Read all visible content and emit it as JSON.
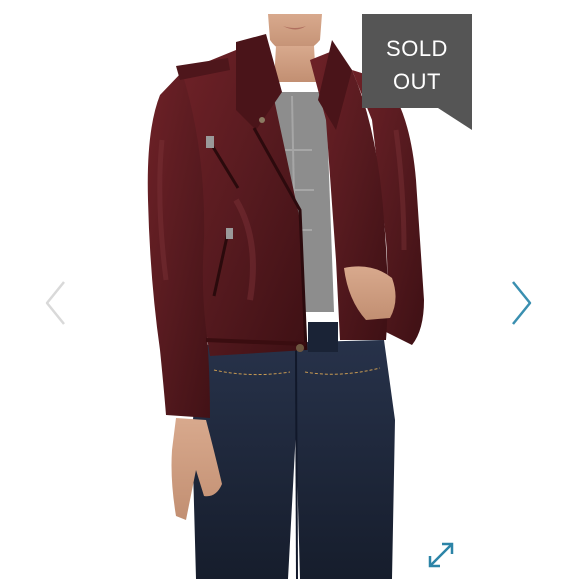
{
  "badge": {
    "line1": "SOLD",
    "line2": "OUT",
    "bg_color": "#555555",
    "text_color": "#ffffff"
  },
  "navigation": {
    "prev_icon": "chevron-left-icon",
    "next_icon": "chevron-right-icon",
    "prev_color": "#d9d9d9",
    "next_color": "#3a8fb0"
  },
  "expand": {
    "icon": "expand-arrows-icon",
    "color": "#2c84a7"
  },
  "product": {
    "jacket_color": "#5b1a1f",
    "jeans_color": "#1f2a3f",
    "top_color": "#8c8c8c"
  }
}
